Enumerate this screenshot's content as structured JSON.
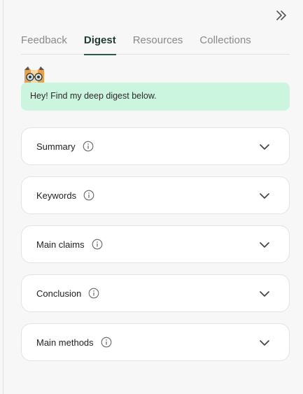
{
  "tabs": [
    {
      "label": "Feedback",
      "active": false
    },
    {
      "label": "Digest",
      "active": true
    },
    {
      "label": "Resources",
      "active": false
    },
    {
      "label": "Collections",
      "active": false
    }
  ],
  "greeting": "Hey! Find my deep digest below.",
  "sections": [
    {
      "label": "Summary"
    },
    {
      "label": "Keywords"
    },
    {
      "label": "Main claims"
    },
    {
      "label": "Conclusion"
    },
    {
      "label": "Main methods"
    }
  ],
  "colors": {
    "accent": "#2f5a4a",
    "greeting_bg": "#ccf5df",
    "page_bg": "#f7f7f7"
  },
  "icons": {
    "collapse": "double-chevron-right-icon",
    "info": "info-icon",
    "expand": "chevron-down-icon",
    "mascot": "cat-mascot-icon"
  }
}
